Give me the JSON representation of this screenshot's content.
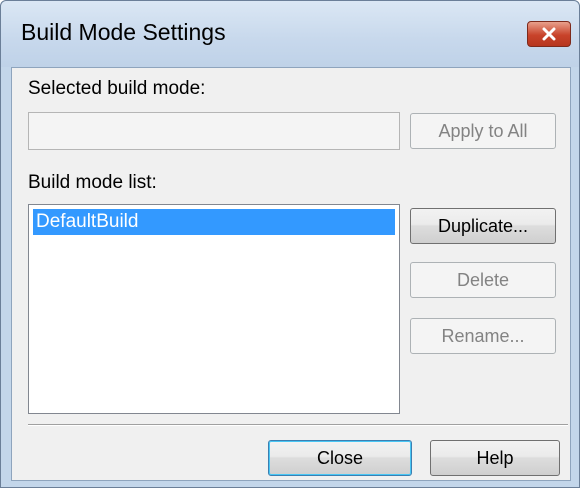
{
  "window": {
    "title": "Build Mode Settings"
  },
  "selected_build_mode": {
    "label": "Selected build mode:",
    "value": ""
  },
  "build_mode_list": {
    "label": "Build mode list:",
    "items": [
      "DefaultBuild"
    ],
    "selected_index": 0
  },
  "buttons": {
    "apply_to_all": "Apply to All",
    "duplicate": "Duplicate...",
    "delete": "Delete",
    "rename": "Rename...",
    "close": "Close",
    "help": "Help"
  },
  "icons": {
    "title_close": "close-icon"
  },
  "colors": {
    "selection": "#3399ff",
    "close_button": "#c8432a",
    "frame": "#c3d6ea"
  }
}
